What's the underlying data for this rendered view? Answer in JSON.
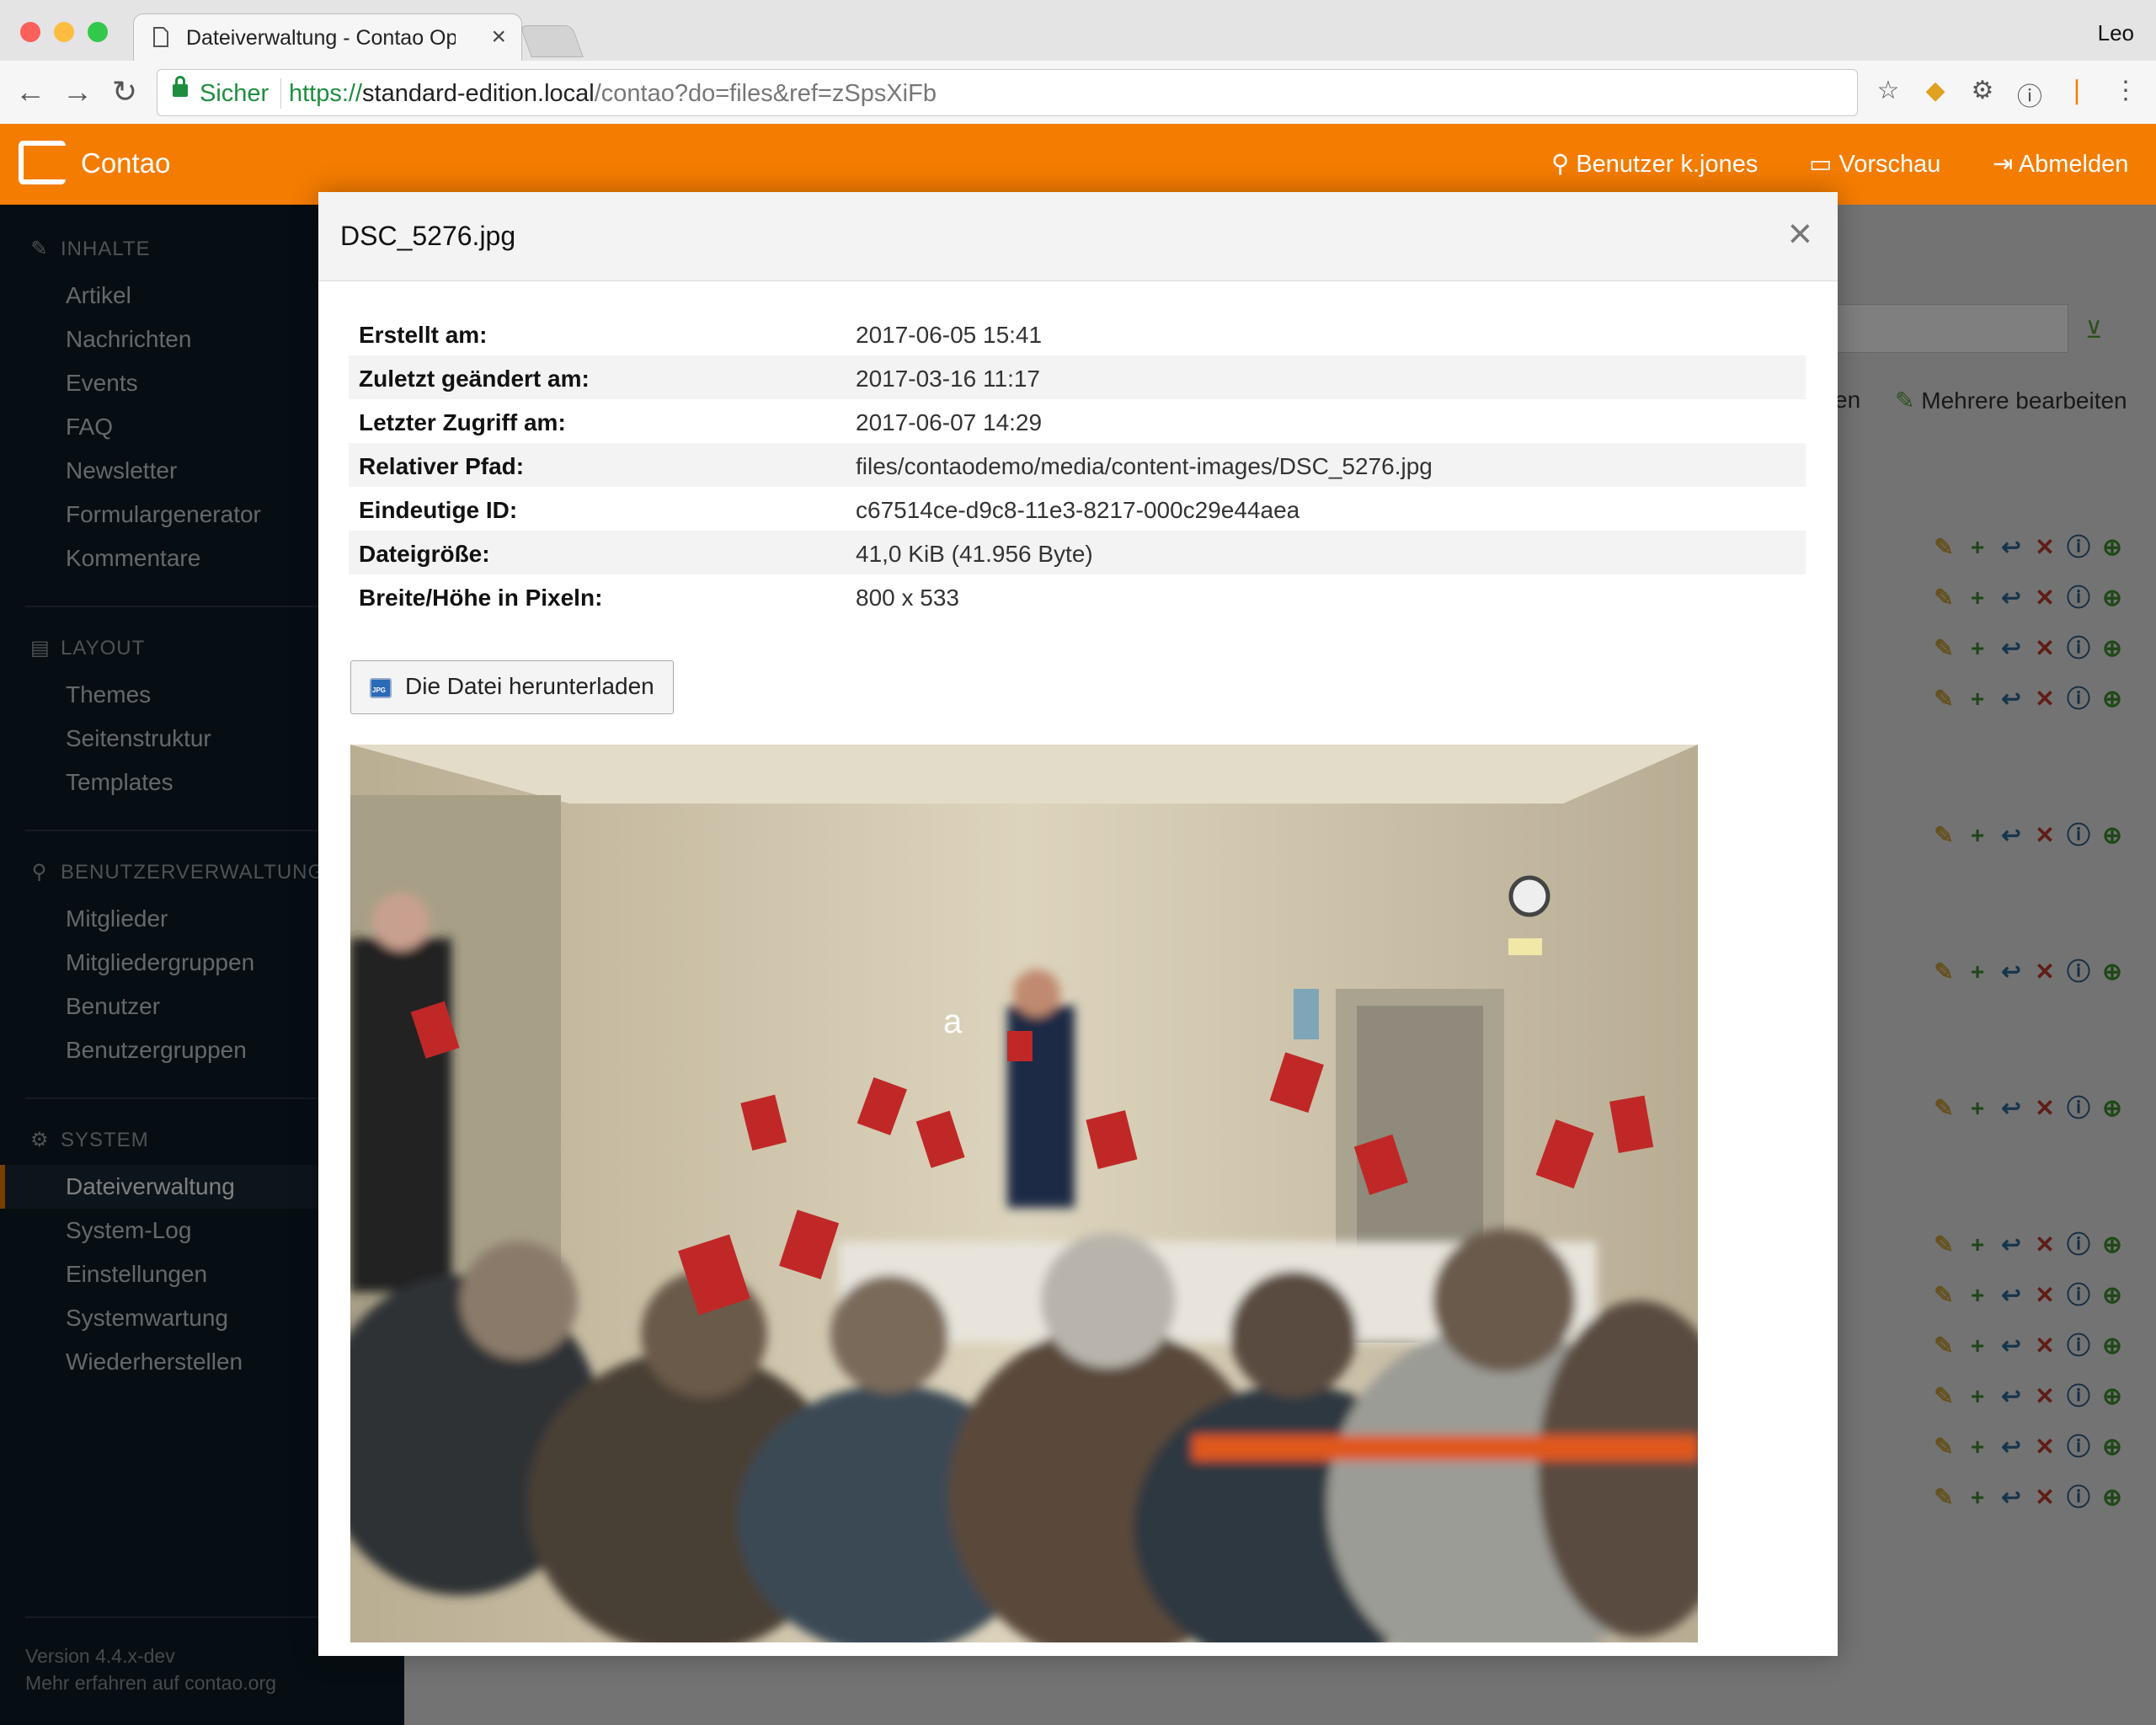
{
  "browser": {
    "tab_title": "Dateiverwaltung - Contao Open Source CMS",
    "user": "Leo",
    "security_label": "Sicher",
    "url_scheme": "https://",
    "url_host": "standard-edition.local",
    "url_path": "/contao?do=files&ref=zSpsXiFb"
  },
  "header": {
    "app_name": "Contao",
    "user_link": "Benutzer k.jones",
    "preview_link": "Vorschau",
    "logout_link": "Abmelden"
  },
  "sidebar": {
    "groups": [
      {
        "title": "INHALTE",
        "items": [
          "Artikel",
          "Nachrichten",
          "Events",
          "FAQ",
          "Newsletter",
          "Formulargenerator",
          "Kommentare"
        ]
      },
      {
        "title": "LAYOUT",
        "items": [
          "Themes",
          "Seitenstruktur",
          "Templates"
        ]
      },
      {
        "title": "BENUTZERVERWALTUNG",
        "items": [
          "Mitglieder",
          "Mitgliedergruppen",
          "Benutzer",
          "Benutzergruppen"
        ]
      },
      {
        "title": "SYSTEM",
        "items": [
          "Dateiverwaltung",
          "System-Log",
          "Einstellungen",
          "Systemwartung",
          "Wiederherstellen"
        ]
      }
    ],
    "active_item": "Dateiverwaltung",
    "version": "Version 4.4.x-dev",
    "more_link": "Mehr erfahren auf contao.org"
  },
  "background": {
    "partial_label": "en",
    "edit_multiple": "Mehrere bearbeiten"
  },
  "modal": {
    "title": "DSC_5276.jpg",
    "info": [
      {
        "label": "Erstellt am:",
        "value": "2017-06-05 15:41"
      },
      {
        "label": "Zuletzt geändert am:",
        "value": "2017-03-16 11:17"
      },
      {
        "label": "Letzter Zugriff am:",
        "value": "2017-06-07 14:29"
      },
      {
        "label": "Relativer Pfad:",
        "value": "files/contaodemo/media/content-images/DSC_5276.jpg"
      },
      {
        "label": "Eindeutige ID:",
        "value": "c67514ce-d9c8-11e3-8217-000c29e44aea"
      },
      {
        "label": "Dateigröße:",
        "value": "41,0 KiB (41.956 Byte)"
      },
      {
        "label": "Breite/Höhe in Pixeln:",
        "value": "800 x 533"
      }
    ],
    "download_label": "Die Datei herunterladen",
    "download_icon_text": "JPG",
    "photo_overlay_text": "a"
  }
}
